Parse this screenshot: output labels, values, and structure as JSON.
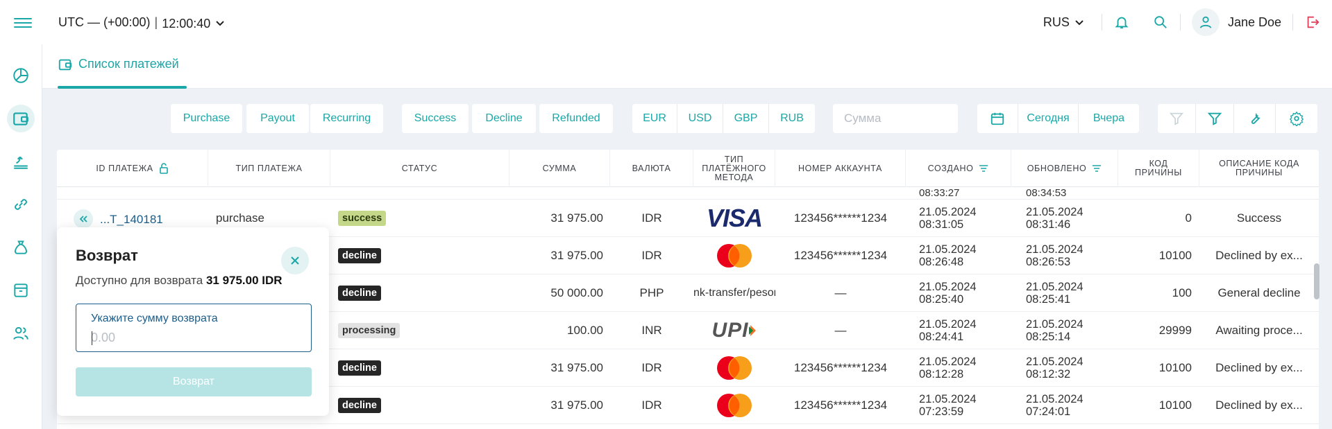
{
  "header": {
    "timezone": "UTC — (+00:00)",
    "separator": "|",
    "time": "12:00:40",
    "language": "RUS",
    "user_name": "Jane Doe"
  },
  "tab": {
    "label": "Список платежей"
  },
  "filters": {
    "type": [
      "Purchase",
      "Payout",
      "Recurring"
    ],
    "status": [
      "Success",
      "Decline",
      "Refunded"
    ],
    "currency": [
      "EUR",
      "USD",
      "GBP",
      "RUB"
    ],
    "amount_placeholder": "Сумма",
    "period": [
      "Сегодня",
      "Вчера"
    ]
  },
  "table": {
    "headers": {
      "id": "ID платежа",
      "type": "Тип платежа",
      "status": "Статус",
      "amount": "Сумма",
      "currency": "Валюта",
      "method": "Тип платёжного метода",
      "account": "Номер аккаунта",
      "created": "Создано",
      "updated": "Обновлено",
      "reason_code": "Код причины",
      "reason_desc": "Описание кода причины"
    },
    "partial_row": {
      "created_time": "08:33:27",
      "updated_time": "08:34:53"
    },
    "rows": [
      {
        "id": "...T_140181",
        "type": "purchase",
        "status": "success",
        "amount": "31 975.00",
        "currency": "IDR",
        "method": "VISA",
        "method_icon": "visa-logo",
        "account": "123456******1234",
        "created_date": "21.05.2024",
        "created_time": "08:31:05",
        "updated_date": "21.05.2024",
        "updated_time": "08:31:46",
        "reason_code": "0",
        "reason_desc": "Success"
      },
      {
        "id": "",
        "type": "",
        "status": "decline",
        "amount": "31 975.00",
        "currency": "IDR",
        "method": "",
        "method_icon": "mastercard-logo",
        "account": "123456******1234",
        "created_date": "21.05.2024",
        "created_time": "08:26:48",
        "updated_date": "21.05.2024",
        "updated_time": "08:26:53",
        "reason_code": "10100",
        "reason_desc": "Declined by ex..."
      },
      {
        "id": "",
        "type": "",
        "status": "decline",
        "amount": "50 000.00",
        "currency": "PHP",
        "method": "nk-transfer/pesor",
        "method_icon": "",
        "account": "—",
        "created_date": "21.05.2024",
        "created_time": "08:25:40",
        "updated_date": "21.05.2024",
        "updated_time": "08:25:41",
        "reason_code": "100",
        "reason_desc": "General decline"
      },
      {
        "id": "",
        "type": "",
        "status": "processing",
        "amount": "100.00",
        "currency": "INR",
        "method": "UPI",
        "method_icon": "upi-logo",
        "account": "—",
        "created_date": "21.05.2024",
        "created_time": "08:24:41",
        "updated_date": "21.05.2024",
        "updated_time": "08:25:14",
        "reason_code": "29999",
        "reason_desc": "Awaiting proce..."
      },
      {
        "id": "",
        "type": "",
        "status": "decline",
        "amount": "31 975.00",
        "currency": "IDR",
        "method": "",
        "method_icon": "mastercard-logo",
        "account": "123456******1234",
        "created_date": "21.05.2024",
        "created_time": "08:12:28",
        "updated_date": "21.05.2024",
        "updated_time": "08:12:32",
        "reason_code": "10100",
        "reason_desc": "Declined by ex..."
      },
      {
        "id": "",
        "type": "",
        "status": "decline",
        "amount": "31 975.00",
        "currency": "IDR",
        "method": "",
        "method_icon": "mastercard-logo",
        "account": "123456******1234",
        "created_date": "21.05.2024",
        "created_time": "07:23:59",
        "updated_date": "21.05.2024",
        "updated_time": "07:24:01",
        "reason_code": "10100",
        "reason_desc": "Declined by ex..."
      }
    ]
  },
  "refund_popup": {
    "title": "Возврат",
    "available_label": "Доступно для возврата",
    "available_amount": "31 975.00 IDR",
    "field_label": "Укажите сумму возврата",
    "field_placeholder": "0.00",
    "submit_label": "Возврат"
  },
  "colors": {
    "accent": "#1aa7a7",
    "logout": "#e0405a"
  }
}
